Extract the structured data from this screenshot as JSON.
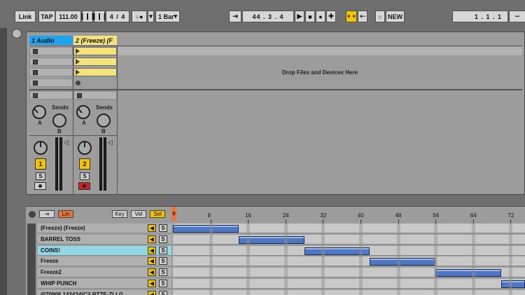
{
  "transport": {
    "link": "Link",
    "tap": "TAP",
    "tempo": "111.00",
    "signature": "4 / 4",
    "metronome": "○●",
    "quantize": "1 Bar",
    "position": "44 .  3 .  4",
    "new": "NEW",
    "loop_position": "1 .  1 .  1"
  },
  "session": {
    "tracks": [
      {
        "name": "1 Audio",
        "number": "1",
        "color": "#1ea3f0"
      },
      {
        "name": "2 (Freeze) (F",
        "number": "2",
        "color": "#f6e27a"
      }
    ],
    "drop_text": "Drop Files and Devices Here",
    "sends_label": "Sends",
    "send_a": "A",
    "send_b": "B",
    "solo": "S"
  },
  "arrangement": {
    "toolbar": {
      "lin": "Lin",
      "key": "Key",
      "vel": "Vel",
      "sel": "Sel"
    },
    "ruler": [
      "0",
      "8",
      "16",
      "24",
      "32",
      "40",
      "48",
      "56",
      "64",
      "72"
    ],
    "tracks": [
      {
        "name": "(Freeze) (Freeze)",
        "selected": false,
        "clip_start_bar": 0,
        "clip_end_bar": 14
      },
      {
        "name": "BARREL TOSS",
        "selected": false,
        "clip_start_bar": 14,
        "clip_end_bar": 28
      },
      {
        "name": "COINS!",
        "selected": true,
        "clip_start_bar": 28,
        "clip_end_bar": 42
      },
      {
        "name": "Freeze",
        "selected": false,
        "clip_start_bar": 42,
        "clip_end_bar": 56
      },
      {
        "name": "Freeze2",
        "selected": false,
        "clip_start_bar": 56,
        "clip_end_bar": 70
      },
      {
        "name": "WHIP PUNCH",
        "selected": false,
        "clip_start_bar": 70,
        "clip_end_bar": 76
      },
      {
        "name": "(070906 142434)C2-RTZE-ZLLG",
        "selected": false,
        "clip_start_bar": null,
        "clip_end_bar": null
      }
    ],
    "solo": "S"
  },
  "colors": {
    "accent_yellow": "#f2c400",
    "clip_blue": "#4f78c4",
    "selected_cyan": "#93d6e6",
    "record_red": "#d02020"
  }
}
